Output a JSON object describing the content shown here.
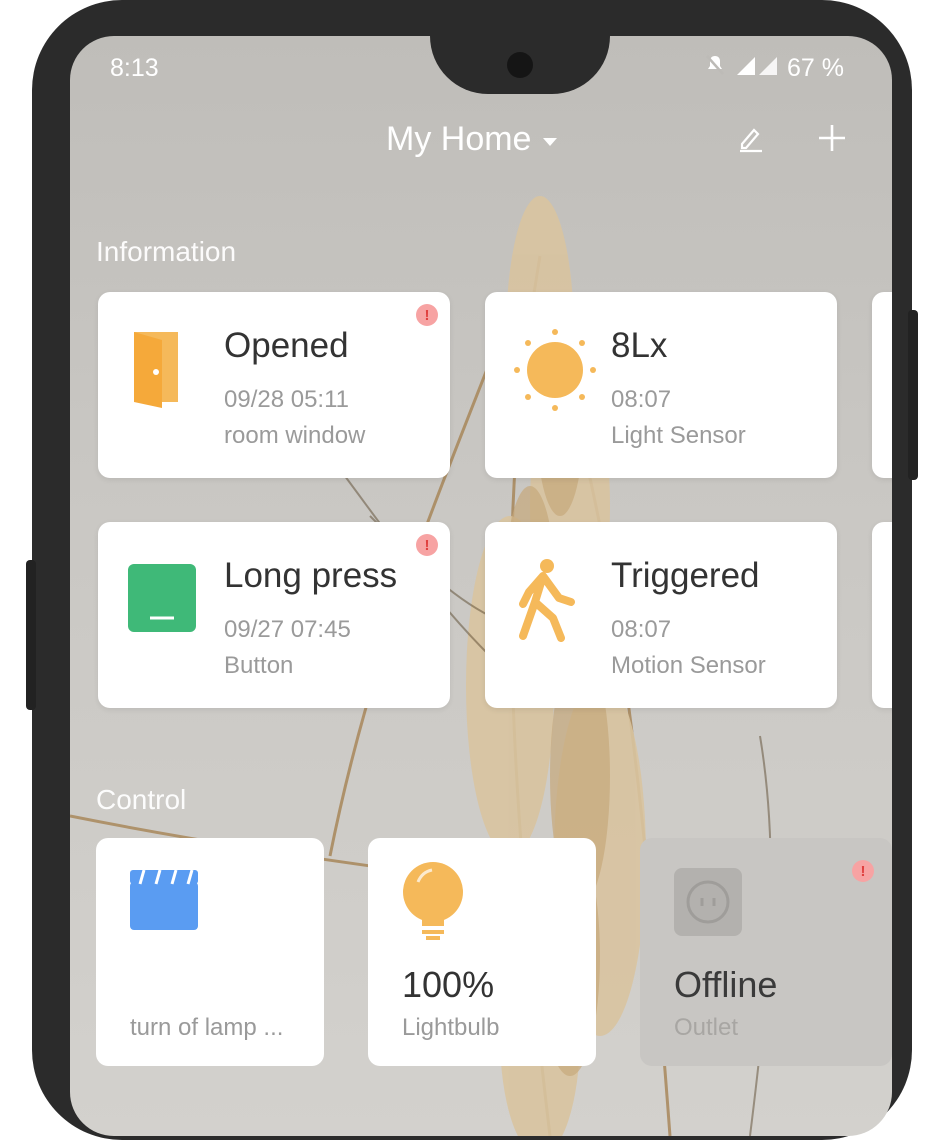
{
  "status_bar": {
    "time": "8:13",
    "battery": "67 %"
  },
  "header": {
    "title": "My Home",
    "icons": [
      "edit-icon",
      "plus-icon"
    ]
  },
  "information": {
    "label": "Information",
    "cards": [
      {
        "main": "Opened",
        "time": "09/28 05:11",
        "sub": "room window",
        "icon": "door-icon",
        "alert": "!"
      },
      {
        "main": "8Lx",
        "time": "08:07",
        "sub": "Light Sensor",
        "icon": "sun-icon"
      },
      {
        "main": "Long press",
        "time": "09/27 07:45",
        "sub": "Button",
        "icon": "button-icon",
        "alert": "!"
      },
      {
        "main": "Triggered",
        "time": "08:07",
        "sub": "Motion Sensor",
        "icon": "walking-person-icon"
      }
    ]
  },
  "control": {
    "label": "Control",
    "cards": [
      {
        "label": "turn of lamp ...",
        "icon": "clapperboard-icon"
      },
      {
        "value": "100%",
        "label": "Lightbulb",
        "icon": "lightbulb-icon"
      },
      {
        "value": "Offline",
        "label": "Outlet",
        "icon": "outlet-icon",
        "alert": "!"
      }
    ]
  },
  "colors": {
    "accent_orange": "#f5b95a",
    "button_green": "#3fb978",
    "scene_blue": "#5a9cf2",
    "alert_red": "#e0403f"
  }
}
